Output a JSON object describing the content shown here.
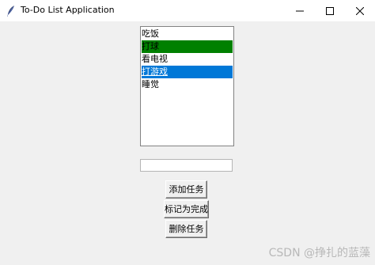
{
  "window": {
    "title": "To-Do List Application",
    "feather_icon": "feather-icon",
    "controls": {
      "minimize_icon": "minimize-icon",
      "maximize_icon": "maximize-icon",
      "close_icon": "close-icon"
    }
  },
  "tasks": {
    "items": [
      {
        "text": "吃饭",
        "state": "normal"
      },
      {
        "text": "打球",
        "state": "completed-green"
      },
      {
        "text": "看电视",
        "state": "normal"
      },
      {
        "text": "打游戏",
        "state": "selected"
      },
      {
        "text": "睡觉",
        "state": "normal"
      }
    ],
    "completed_color": "#008000",
    "selection_color": "#0078d7"
  },
  "task_entry": {
    "value": "",
    "placeholder": ""
  },
  "buttons": {
    "add_label": "添加任务",
    "mark_done_label": "标记为完成",
    "delete_label": "删除任务"
  },
  "watermark": "CSDN @挣扎的蓝藻"
}
